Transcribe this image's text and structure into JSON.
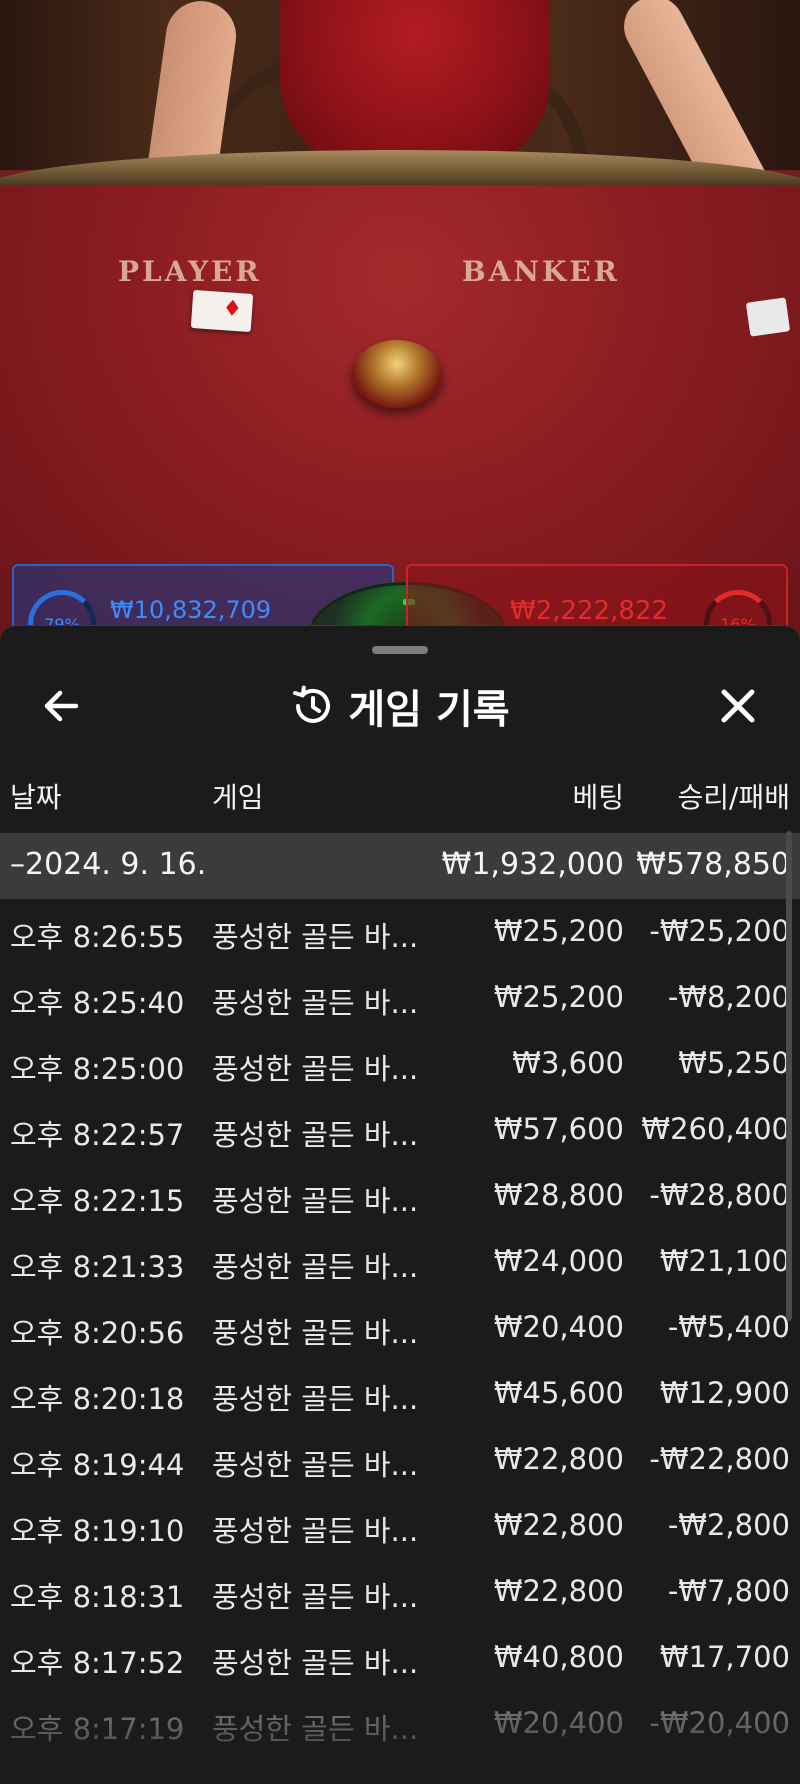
{
  "video": {
    "player_label": "PLAYER",
    "banker_label": "BANKER",
    "player_amount": "₩10,832,709",
    "banker_amount": "₩2,222,822",
    "player_pct": "79%",
    "banker_pct": "16%",
    "player_color": "#2a6fe0",
    "banker_color": "#e42b2b"
  },
  "header": {
    "title": "게임 기록",
    "back_icon": "arrow-left-icon",
    "history_icon": "history-icon",
    "close_icon": "close-icon"
  },
  "columns": {
    "date": "날짜",
    "game": "게임",
    "bet": "베팅",
    "winloss": "승리/패배"
  },
  "group": {
    "date": "–2024. 9. 16.",
    "bet": "₩1,932,000",
    "winloss": "₩578,850"
  },
  "rows": [
    {
      "time": "오후 8:26:55",
      "game": "풍성한 골든 바...",
      "bet": "₩25,200",
      "winloss": "-₩25,200"
    },
    {
      "time": "오후 8:25:40",
      "game": "풍성한 골든 바...",
      "bet": "₩25,200",
      "winloss": "-₩8,200"
    },
    {
      "time": "오후 8:25:00",
      "game": "풍성한 골든 바...",
      "bet": "₩3,600",
      "winloss": "₩5,250"
    },
    {
      "time": "오후 8:22:57",
      "game": "풍성한 골든 바...",
      "bet": "₩57,600",
      "winloss": "₩260,400"
    },
    {
      "time": "오후 8:22:15",
      "game": "풍성한 골든 바...",
      "bet": "₩28,800",
      "winloss": "-₩28,800"
    },
    {
      "time": "오후 8:21:33",
      "game": "풍성한 골든 바...",
      "bet": "₩24,000",
      "winloss": "₩21,100"
    },
    {
      "time": "오후 8:20:56",
      "game": "풍성한 골든 바...",
      "bet": "₩20,400",
      "winloss": "-₩5,400"
    },
    {
      "time": "오후 8:20:18",
      "game": "풍성한 골든 바...",
      "bet": "₩45,600",
      "winloss": "₩12,900"
    },
    {
      "time": "오후 8:19:44",
      "game": "풍성한 골든 바...",
      "bet": "₩22,800",
      "winloss": "-₩22,800"
    },
    {
      "time": "오후 8:19:10",
      "game": "풍성한 골든 바...",
      "bet": "₩22,800",
      "winloss": "-₩2,800"
    },
    {
      "time": "오후 8:18:31",
      "game": "풍성한 골든 바...",
      "bet": "₩22,800",
      "winloss": "-₩7,800"
    },
    {
      "time": "오후 8:17:52",
      "game": "풍성한 골든 바...",
      "bet": "₩40,800",
      "winloss": "₩17,700"
    },
    {
      "time": "오후 8:17:19",
      "game": "풍성한 골든 바...",
      "bet": "₩20,400",
      "winloss": "-₩20,400"
    }
  ]
}
